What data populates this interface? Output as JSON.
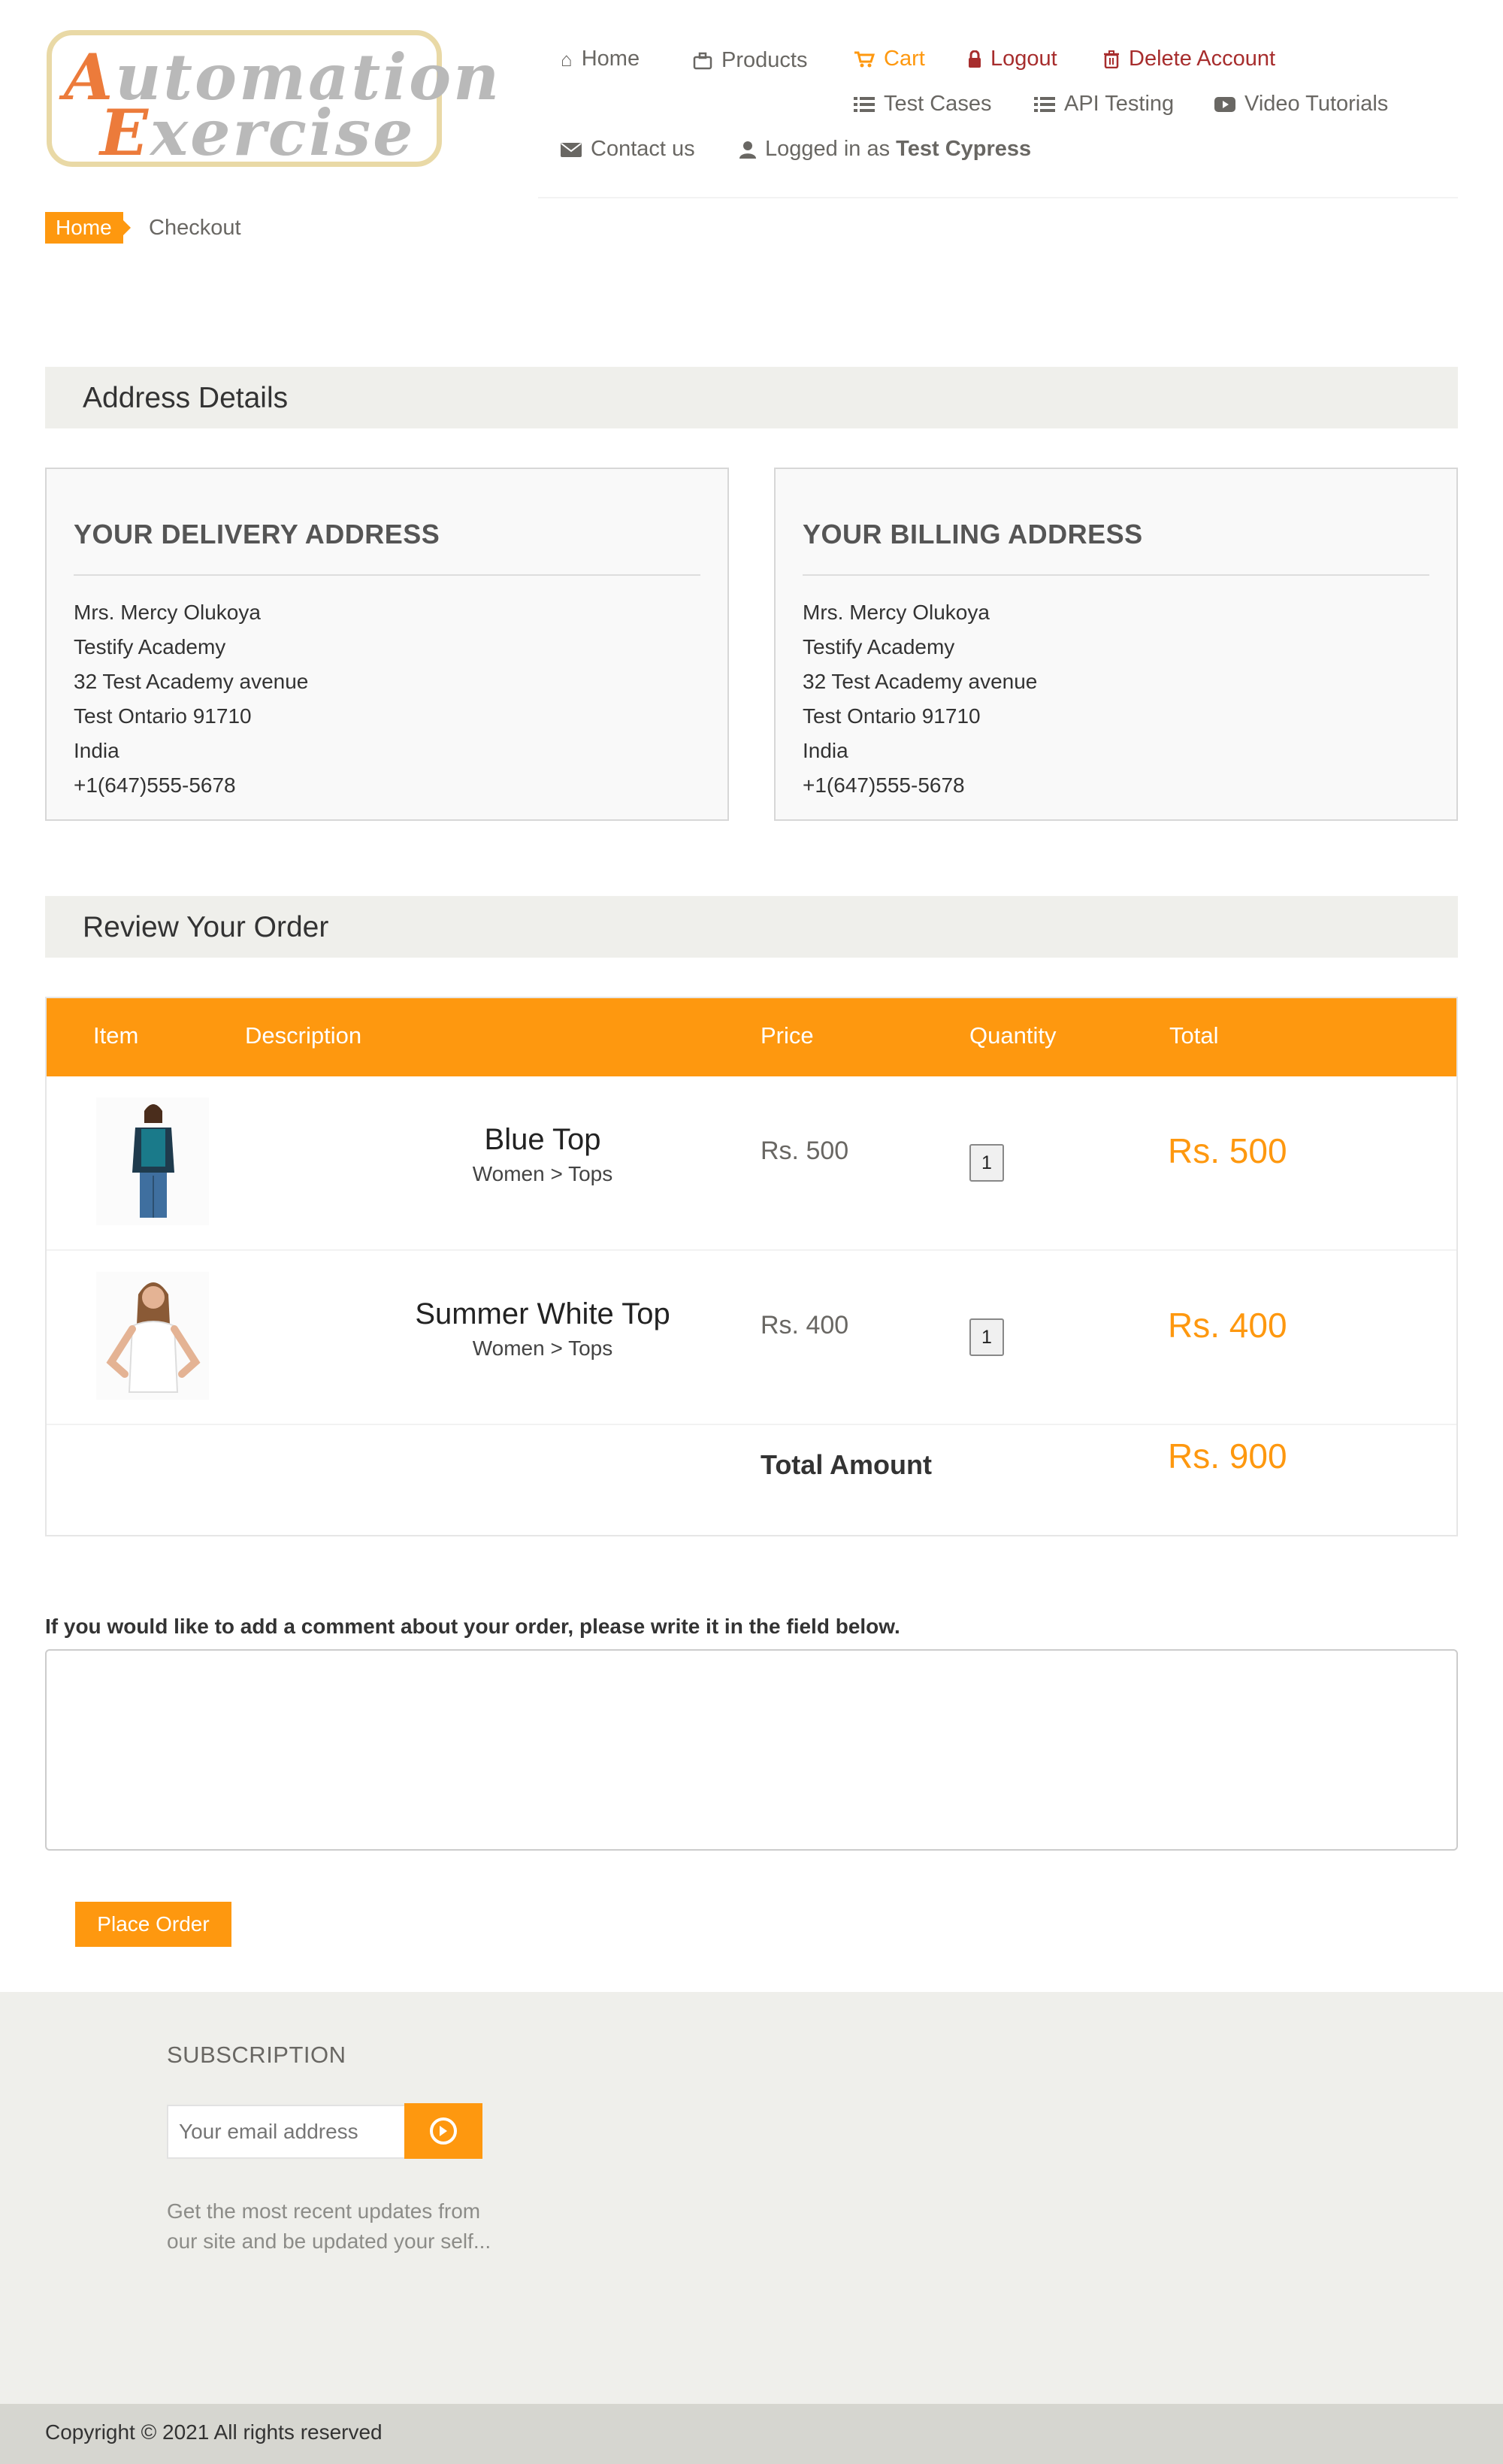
{
  "logo": {
    "line1_first": "A",
    "line1_rest": "utomation",
    "line2_first": "E",
    "line2_rest": "xercise"
  },
  "nav": {
    "home": "Home",
    "products": "Products",
    "cart": "Cart",
    "logout": "Logout",
    "delete_account": "Delete Account",
    "test_cases": "Test Cases",
    "api_testing": "API Testing",
    "video_tutorials": "Video Tutorials",
    "contact_us": "Contact us",
    "logged_in_prefix": "Logged in as",
    "logged_in_user": "Test Cypress"
  },
  "breadcrumb": {
    "home": "Home",
    "current": "Checkout"
  },
  "address_section": {
    "title": "Address Details"
  },
  "delivery": {
    "title": "YOUR DELIVERY ADDRESS",
    "lines": [
      "Mrs. Mercy Olukoya",
      "Testify Academy",
      "32 Test Academy avenue",
      "Test Ontario 91710",
      "India",
      "+1(647)555-5678"
    ]
  },
  "billing": {
    "title": "YOUR BILLING ADDRESS",
    "lines": [
      "Mrs. Mercy Olukoya",
      "Testify Academy",
      "32 Test Academy avenue",
      "Test Ontario 91710",
      "India",
      "+1(647)555-5678"
    ]
  },
  "review_section": {
    "title": "Review Your Order"
  },
  "table": {
    "headers": [
      "Item",
      "Description",
      "Price",
      "Quantity",
      "Total"
    ],
    "rows": [
      {
        "name": "Blue Top",
        "category": "Women > Tops",
        "price": "Rs. 500",
        "quantity": "1",
        "total": "Rs. 500"
      },
      {
        "name": "Summer White Top",
        "category": "Women > Tops",
        "price": "Rs. 400",
        "quantity": "1",
        "total": "Rs. 400"
      }
    ],
    "total_label": "Total Amount",
    "total_amount": "Rs. 900"
  },
  "comment": {
    "label": "If you would like to add a comment about your order, please write it in the field below.",
    "value": ""
  },
  "place_order": "Place Order",
  "footer": {
    "subscription_title": "SUBSCRIPTION",
    "email_placeholder": "Your email address",
    "subscription_text": "Get the most recent updates from our site and be updated your self...",
    "copyright": "Copyright © 2021 All rights reserved"
  },
  "colors": {
    "accent": "#fe980f",
    "danger": "#a72d2d",
    "panel": "#efefeb"
  }
}
